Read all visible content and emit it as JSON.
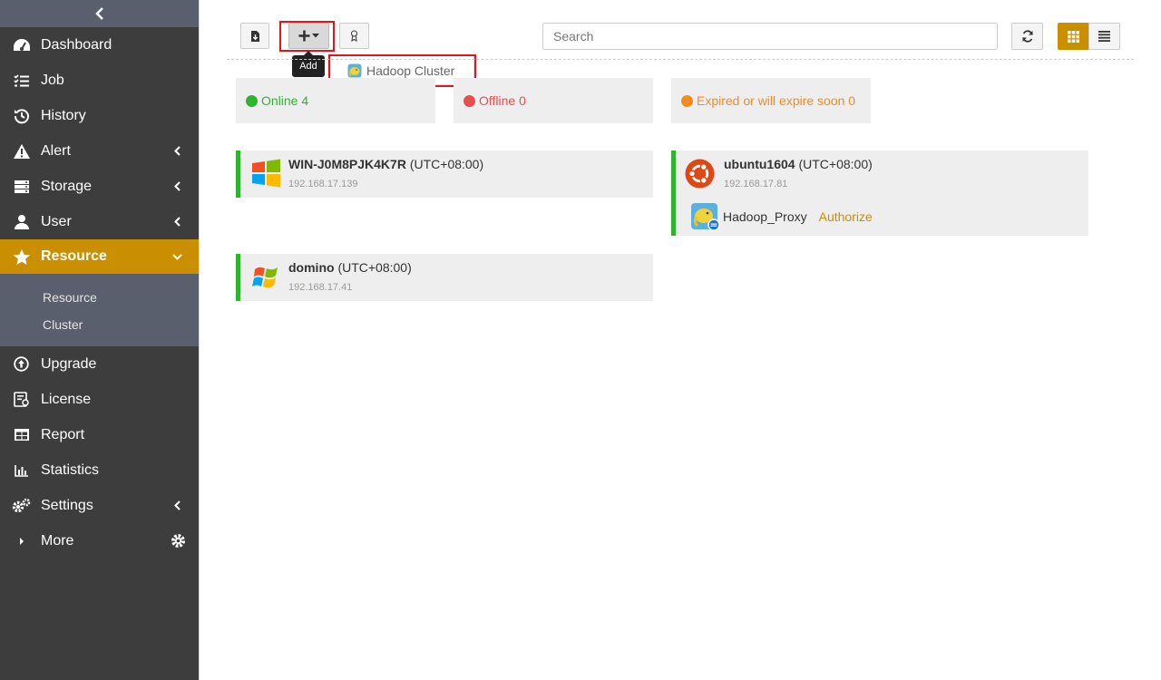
{
  "sidebar": {
    "items": [
      {
        "label": "Dashboard",
        "icon": "dashboard-icon"
      },
      {
        "label": "Job",
        "icon": "job-list-icon"
      },
      {
        "label": "History",
        "icon": "history-icon"
      },
      {
        "label": "Alert",
        "icon": "alert-icon"
      },
      {
        "label": "Storage",
        "icon": "storage-icon"
      },
      {
        "label": "User",
        "icon": "user-icon"
      },
      {
        "label": "Resource",
        "icon": "star-icon"
      }
    ],
    "resource_sub": [
      "Resource",
      "Cluster"
    ],
    "bottom_items": [
      {
        "label": "Upgrade",
        "icon": "upgrade-icon"
      },
      {
        "label": "License",
        "icon": "license-icon"
      },
      {
        "label": "Report",
        "icon": "report-icon"
      },
      {
        "label": "Statistics",
        "icon": "statistics-icon"
      },
      {
        "label": "Settings",
        "icon": "settings-icon"
      },
      {
        "label": "More",
        "icon": "caret-right-icon"
      }
    ],
    "active_color": "#c98f00"
  },
  "toolbar": {
    "add_tooltip": "Add",
    "dropdown_item": "Hadoop Cluster",
    "search_placeholder": "Search",
    "grid_view_color": "#c98f00"
  },
  "status": {
    "online": "Online 4",
    "offline": "Offline 0",
    "expired": "Expired or will expire soon 0",
    "colors": {
      "online": "#2db52d",
      "offline": "#e84e4e",
      "expired": "#f58a1f"
    }
  },
  "hosts": [
    {
      "name": "WIN-J0M8PJK4K7R",
      "tz": "(UTC+08:00)",
      "ip": "192.168.17.139",
      "os": "windows-icon"
    },
    {
      "name": "ubuntu1604",
      "tz": "(UTC+08:00)",
      "ip": "192.168.17.81",
      "os": "ubuntu-icon",
      "app": "Hadoop_Proxy",
      "action": "Authorize"
    },
    {
      "name": "domino",
      "tz": "(UTC+08:00)",
      "ip": "192.168.17.41",
      "os": "windows-xp-icon"
    }
  ]
}
